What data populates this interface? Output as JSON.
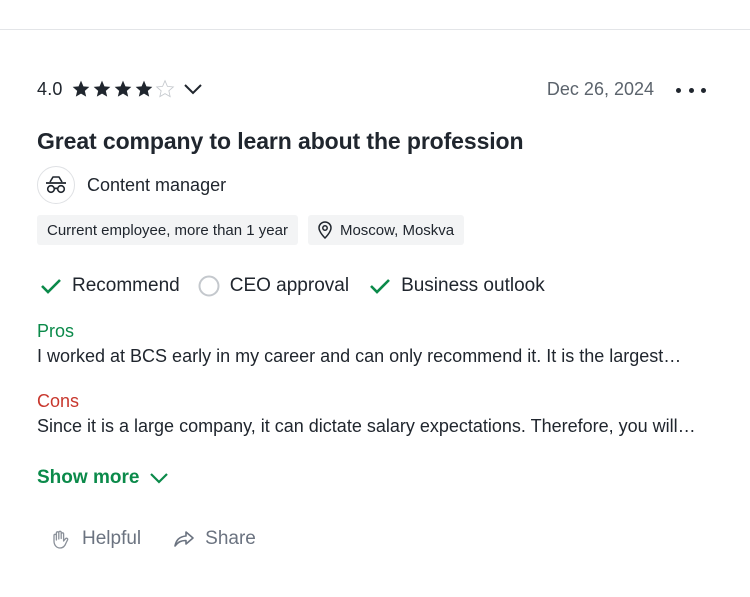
{
  "review": {
    "rating": "4.0",
    "stars_filled": 4,
    "stars_total": 5,
    "date": "Dec 26, 2024",
    "title": "Great company to learn about the profession",
    "job_title": "Content manager",
    "tags": {
      "employment": "Current employee, more than 1 year",
      "location": "Moscow, Moskva"
    },
    "ratings": {
      "recommend": "Recommend",
      "ceo_approval": "CEO approval",
      "business_outlook": "Business outlook"
    },
    "pros_label": "Pros",
    "pros_text": "I worked at BCS early in my career and can only recommend it. It is the largest…",
    "cons_label": "Cons",
    "cons_text": "Since it is a large company, it can dictate salary expectations. Therefore, you will…",
    "show_more": "Show more",
    "actions": {
      "helpful": "Helpful",
      "share": "Share"
    }
  },
  "colors": {
    "positive": "#0b8a4a",
    "negative": "#c8372d",
    "text": "#20262e",
    "muted": "#6b7380"
  },
  "icons": [
    "star-filled-icon",
    "star-empty-icon",
    "chevron-down-icon",
    "more-options-icon",
    "job-icon",
    "location-pin-icon",
    "checkmark-icon",
    "neutral-circle-icon",
    "helpful-hands-icon",
    "share-arrow-icon"
  ]
}
